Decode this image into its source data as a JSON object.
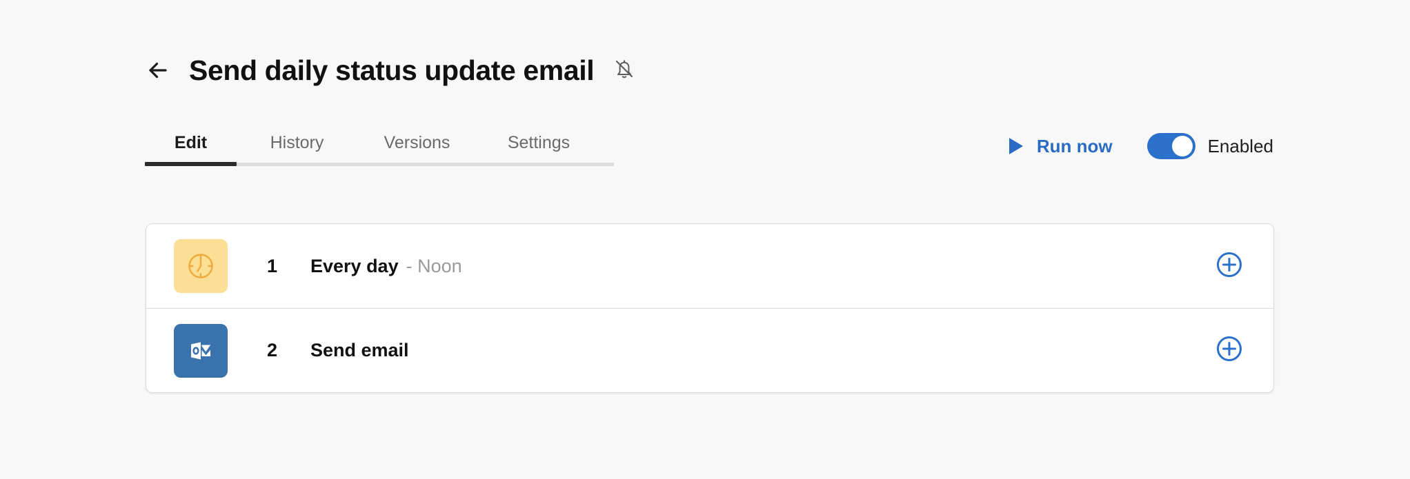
{
  "header": {
    "back_icon": "arrow-left-icon",
    "title": "Send daily status update email",
    "notifications_icon": "bell-off-icon"
  },
  "tabs": [
    {
      "label": "Edit",
      "active": true
    },
    {
      "label": "History",
      "active": false
    },
    {
      "label": "Versions",
      "active": false
    },
    {
      "label": "Settings",
      "active": false
    }
  ],
  "actions": {
    "run_now_label": "Run now",
    "run_now_icon": "play-icon",
    "toggle_label": "Enabled",
    "toggle_on": true
  },
  "steps": [
    {
      "number": "1",
      "icon": "clock-icon",
      "title": "Every day",
      "subtitle": "- Noon",
      "add_icon": "plus-circle-icon"
    },
    {
      "number": "2",
      "icon": "outlook-icon",
      "title": "Send email",
      "subtitle": "",
      "add_icon": "plus-circle-icon"
    }
  ],
  "colors": {
    "accent_blue": "#2b70ca",
    "link_blue": "#2a6cc4",
    "clock_bg": "#fadf95",
    "clock_stroke": "#f0a93c",
    "outlook_bg": "#3a72ad",
    "page_bg": "#f8f8f8",
    "active_tab_underline": "#2b2b2b"
  }
}
